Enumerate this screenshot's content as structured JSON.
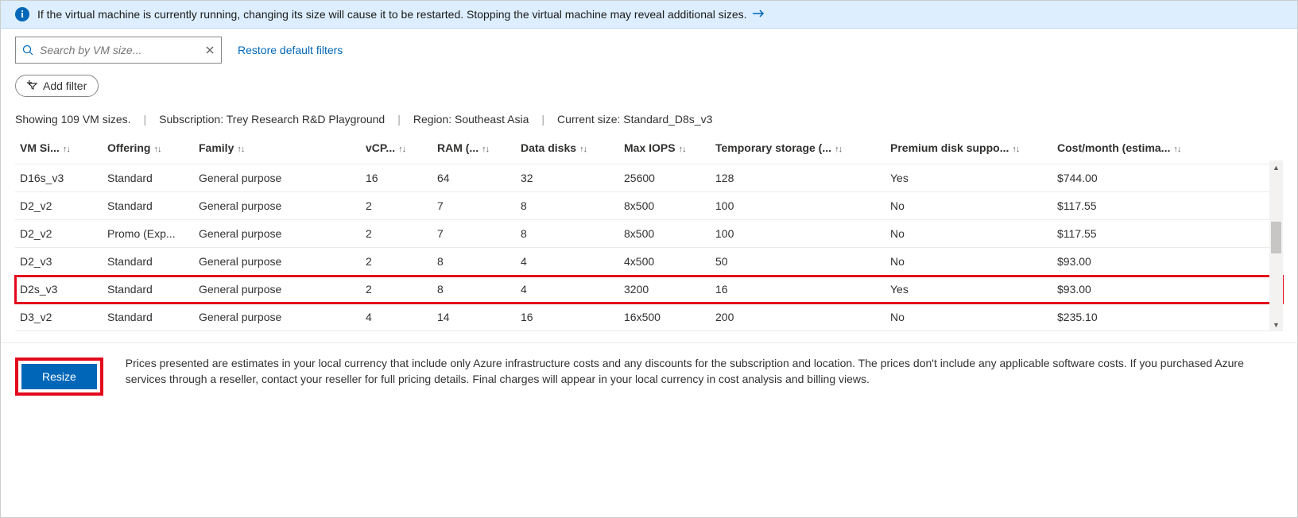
{
  "notice": {
    "text": "If the virtual machine is currently running, changing its size will cause it to be restarted. Stopping the virtual machine may reveal additional sizes."
  },
  "search": {
    "placeholder": "Search by VM size..."
  },
  "links": {
    "restore": "Restore default filters"
  },
  "add_filter_label": "Add filter",
  "summary": {
    "count": "Showing 109 VM sizes.",
    "subscription_label": "Subscription:",
    "subscription_value": "Trey Research R&D Playground",
    "region_label": "Region:",
    "region_value": "Southeast Asia",
    "current_label": "Current size:",
    "current_value": "Standard_D8s_v3"
  },
  "columns": [
    "VM Si...",
    "Offering",
    "Family",
    "vCP...",
    "RAM (...",
    "Data disks",
    "Max IOPS",
    "Temporary storage (...",
    "Premium disk suppo...",
    "Cost/month (estima..."
  ],
  "rows": [
    {
      "cells": [
        "D16s_v3",
        "Standard",
        "General purpose",
        "16",
        "64",
        "32",
        "25600",
        "128",
        "Yes",
        "$744.00"
      ],
      "hl": false
    },
    {
      "cells": [
        "D2_v2",
        "Standard",
        "General purpose",
        "2",
        "7",
        "8",
        "8x500",
        "100",
        "No",
        "$117.55"
      ],
      "hl": false
    },
    {
      "cells": [
        "D2_v2",
        "Promo (Exp...",
        "General purpose",
        "2",
        "7",
        "8",
        "8x500",
        "100",
        "No",
        "$117.55"
      ],
      "hl": false
    },
    {
      "cells": [
        "D2_v3",
        "Standard",
        "General purpose",
        "2",
        "8",
        "4",
        "4x500",
        "50",
        "No",
        "$93.00"
      ],
      "hl": false
    },
    {
      "cells": [
        "D2s_v3",
        "Standard",
        "General purpose",
        "2",
        "8",
        "4",
        "3200",
        "16",
        "Yes",
        "$93.00"
      ],
      "hl": true
    },
    {
      "cells": [
        "D3_v2",
        "Standard",
        "General purpose",
        "4",
        "14",
        "16",
        "16x500",
        "200",
        "No",
        "$235.10"
      ],
      "hl": false
    }
  ],
  "footer": {
    "resize": "Resize",
    "disclaimer": "Prices presented are estimates in your local currency that include only Azure infrastructure costs and any discounts for the subscription and location. The prices don't include any applicable software costs. If you purchased Azure services through a reseller, contact your reseller for full pricing details. Final charges will appear in your local currency in cost analysis and billing views."
  }
}
